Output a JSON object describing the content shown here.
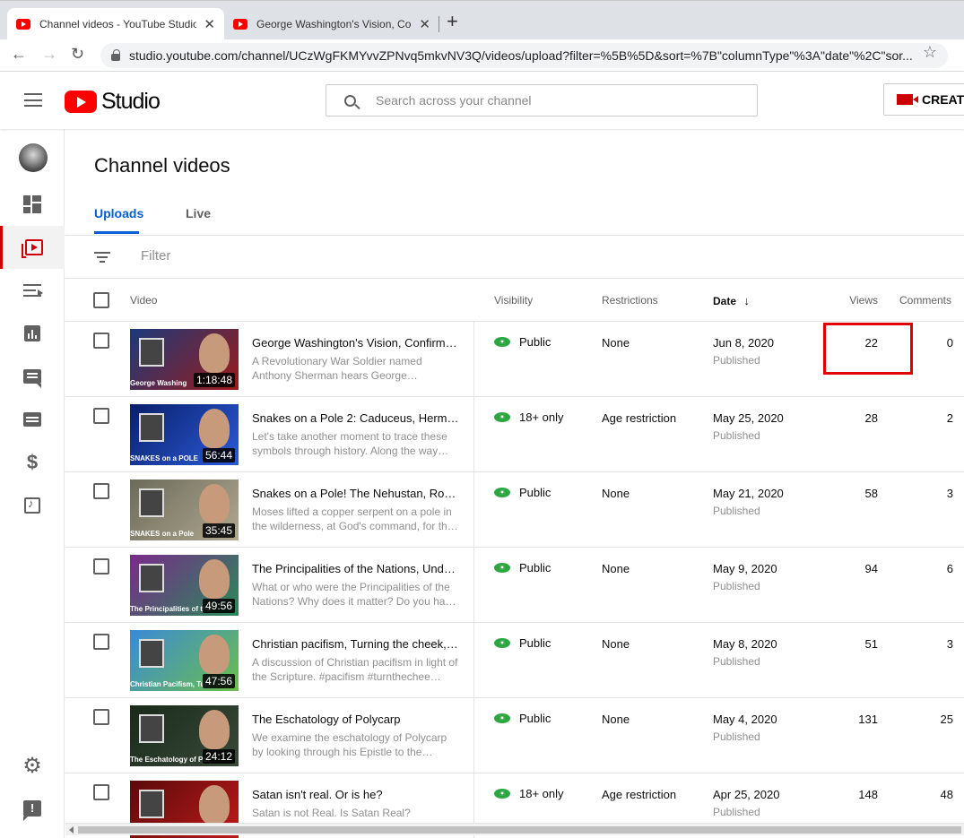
{
  "browser": {
    "tabs": [
      {
        "title": "Channel videos - YouTube Studio"
      },
      {
        "title": "George Washington's Vision, Cor"
      }
    ],
    "url": "studio.youtube.com/channel/UCzWgFKMYvvZPNvq5mkvNV3Q/videos/upload?filter=%5B%5D&sort=%7B\"columnType\"%3A\"date\"%2C\"sor..."
  },
  "header": {
    "brand": "Studio",
    "search_placeholder": "Search across your channel",
    "create_label": "CREATE"
  },
  "page": {
    "title": "Channel videos",
    "tabs": [
      "Uploads",
      "Live"
    ],
    "filter_placeholder": "Filter"
  },
  "table": {
    "columns": {
      "video": "Video",
      "visibility": "Visibility",
      "restrictions": "Restrictions",
      "date": "Date",
      "views": "Views",
      "comments": "Comments"
    },
    "rows": [
      {
        "title": "George Washington's Vision, Confirme…",
        "description": "A Revolutionary War Soldier named Anthony Sherman hears George…",
        "duration": "1:18:48",
        "visibility": "Public",
        "restrictions": "None",
        "date": "Jun 8, 2020",
        "status": "Published",
        "views": "22",
        "comments": "0",
        "thumb_colors": [
          "#1b3a7a",
          "#9b1b1b"
        ],
        "thumb_caption": "George Washing"
      },
      {
        "title": "Snakes on a Pole 2: Caduceus, Herme…",
        "description": "Let's take another moment to trace these symbols through history. Along the way…",
        "duration": "56:44",
        "visibility": "18+ only",
        "restrictions": "Age restriction",
        "date": "May 25, 2020",
        "status": "Published",
        "views": "28",
        "comments": "2",
        "thumb_colors": [
          "#0a1f6b",
          "#2a5bd7"
        ],
        "thumb_caption": "SNAKES on a POLE"
      },
      {
        "title": "Snakes on a Pole! The Nehustan, Rod …",
        "description": "Moses lifted a copper serpent on a pole in the wilderness, at God's command, for th…",
        "duration": "35:45",
        "visibility": "Public",
        "restrictions": "None",
        "date": "May 21, 2020",
        "status": "Published",
        "views": "58",
        "comments": "3",
        "thumb_colors": [
          "#6b6b5a",
          "#b0a890"
        ],
        "thumb_caption": "SNAKES on a Pole"
      },
      {
        "title": "The Principalities of the Nations, Unde…",
        "description": "What or who were the Principalities of the Nations? Why does it matter? Do you ha…",
        "duration": "49:56",
        "visibility": "Public",
        "restrictions": "None",
        "date": "May 9, 2020",
        "status": "Published",
        "views": "94",
        "comments": "6",
        "thumb_colors": [
          "#7a2a8a",
          "#2a8a5a"
        ],
        "thumb_caption": "The Principalities of the Nat"
      },
      {
        "title": "Christian pacifism, Turning the cheek, …",
        "description": "A discussion of Christian pacifism in light of the Scripture. #pacifism #turnthechee…",
        "duration": "47:56",
        "visibility": "Public",
        "restrictions": "None",
        "date": "May 8, 2020",
        "status": "Published",
        "views": "51",
        "comments": "3",
        "thumb_colors": [
          "#3a8ad7",
          "#6bbf4a"
        ],
        "thumb_caption": "Christian Pacifism, Turning t"
      },
      {
        "title": "The Eschatology of Polycarp",
        "description": "We examine the eschatology of Polycarp by looking through his Epistle to the…",
        "duration": "24:12",
        "visibility": "Public",
        "restrictions": "None",
        "date": "May 4, 2020",
        "status": "Published",
        "views": "131",
        "comments": "25",
        "thumb_colors": [
          "#1a2a1a",
          "#3a4a3a"
        ],
        "thumb_caption": "The Eschatology of Polyc"
      },
      {
        "title": "Satan isn't real. Or is he?",
        "description": "Satan is not Real. Is Satan Real?",
        "duration": "",
        "visibility": "18+ only",
        "restrictions": "Age restriction",
        "date": "Apr 25, 2020",
        "status": "Published",
        "views": "148",
        "comments": "48",
        "thumb_colors": [
          "#5a0a0a",
          "#c01a1a"
        ],
        "thumb_caption": ""
      }
    ]
  },
  "colors": {
    "accent": "#065fd4",
    "brand_red": "#ff0000",
    "public_eye": "#2ba640",
    "highlight_box": "#e00000"
  },
  "icons": [
    "menu-icon",
    "youtube-logo-icon",
    "search-icon",
    "camera-icon",
    "dashboard-icon",
    "videos-icon",
    "playlists-icon",
    "analytics-icon",
    "comments-icon",
    "subtitles-icon",
    "monetization-icon",
    "audio-library-icon",
    "settings-icon",
    "feedback-icon",
    "filter-icon",
    "sort-down-icon",
    "eye-icon"
  ]
}
